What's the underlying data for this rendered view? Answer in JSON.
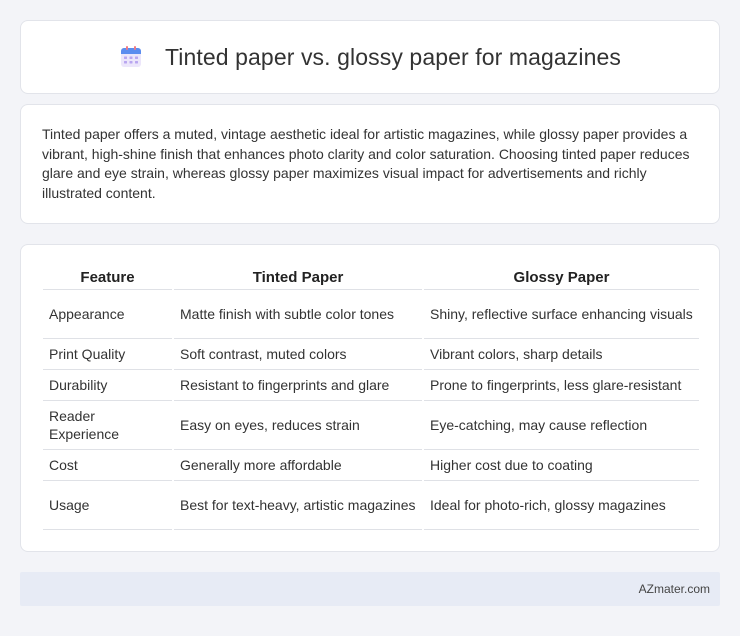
{
  "header": {
    "title": "Tinted paper vs. glossy paper for magazines",
    "icon": "calendar-icon"
  },
  "intro": {
    "text": "Tinted paper offers a muted, vintage aesthetic ideal for artistic magazines, while glossy paper provides a vibrant, high-shine finish that enhances photo clarity and color saturation. Choosing tinted paper reduces glare and eye strain, whereas glossy paper maximizes visual impact for advertisements and richly illustrated content."
  },
  "table": {
    "headers": [
      "Feature",
      "Tinted Paper",
      "Glossy Paper"
    ],
    "rows": [
      [
        "Appearance",
        "Matte finish with subtle color tones",
        "Shiny, reflective surface enhancing visuals"
      ],
      [
        "Print Quality",
        "Soft contrast, muted colors",
        "Vibrant colors, sharp details"
      ],
      [
        "Durability",
        "Resistant to fingerprints and glare",
        "Prone to fingerprints, less glare-resistant"
      ],
      [
        "Reader Experience",
        "Easy on eyes, reduces strain",
        "Eye-catching, may cause reflection"
      ],
      [
        "Cost",
        "Generally more affordable",
        "Higher cost due to coating"
      ],
      [
        "Usage",
        "Best for text-heavy, artistic magazines",
        "Ideal for photo-rich, glossy magazines"
      ]
    ]
  },
  "footer": {
    "site": "AZmater.com"
  },
  "colors": {
    "page_background": "#f3f4f8",
    "card_background": "#ffffff",
    "footer_background": "#e7ebf5"
  }
}
